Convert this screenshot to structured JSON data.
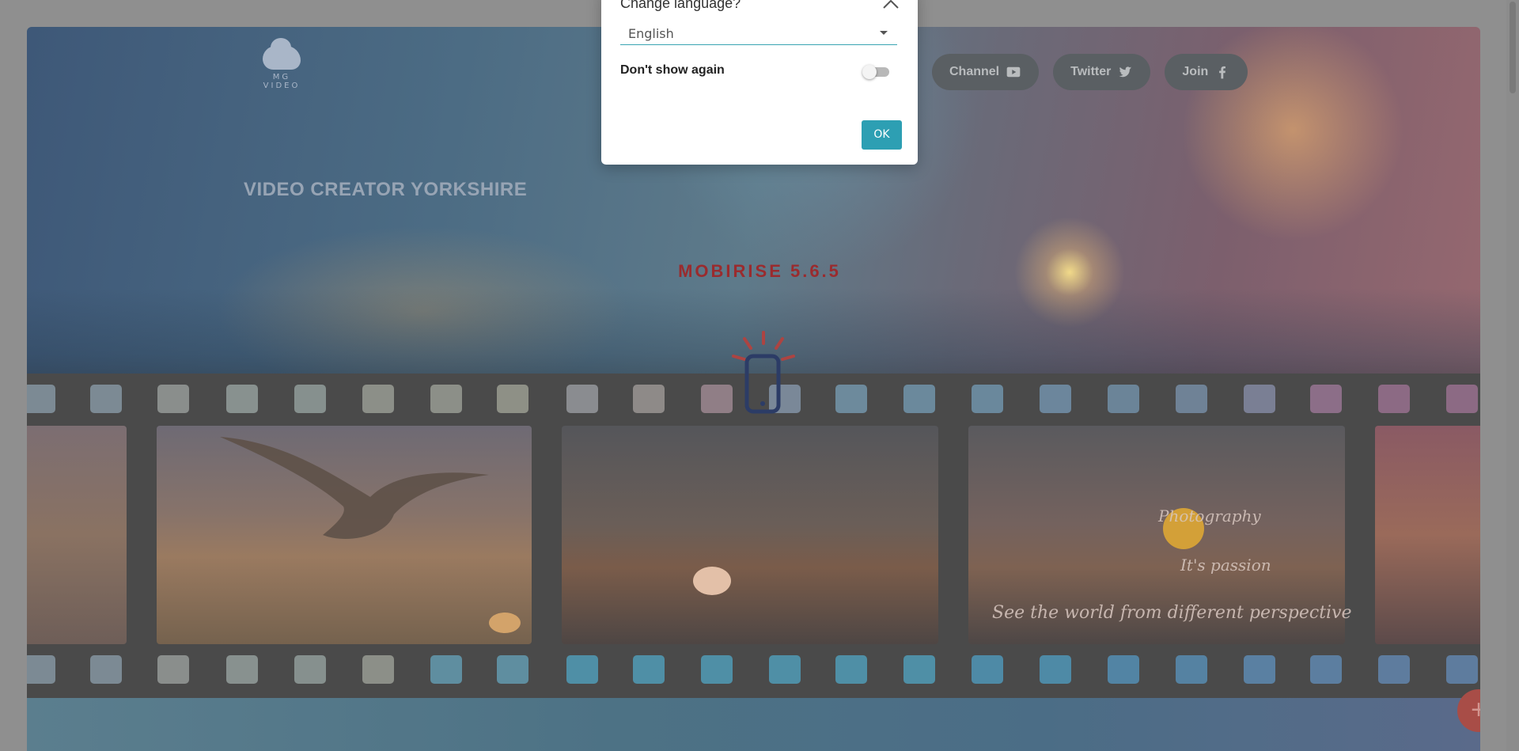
{
  "header": {
    "logo_text": "MG\nVIDEO",
    "nav": [
      {
        "label": "Channel",
        "icon": "youtube-icon"
      },
      {
        "label": "Twitter",
        "icon": "twitter-icon"
      },
      {
        "label": "Join",
        "icon": "facebook-icon"
      }
    ]
  },
  "hero": {
    "site_title": "VIDEO CREATOR YORKSHIRE",
    "builder_label": "MOBIRISE  5.6.5",
    "script_lines": [
      "Photography",
      "It's passion",
      "See the world from different perspective"
    ]
  },
  "dialog": {
    "title": "Change language?",
    "language_value": "English",
    "dont_show_label": "Don't show again",
    "dont_show_checked": false,
    "ok_label": "OK"
  },
  "fab": {
    "icon": "plus-icon",
    "label": "+"
  },
  "colors": {
    "accent": "#2d9fb3",
    "overlay": "#8f8f8f",
    "mobirise_red": "#9a2b2e"
  }
}
